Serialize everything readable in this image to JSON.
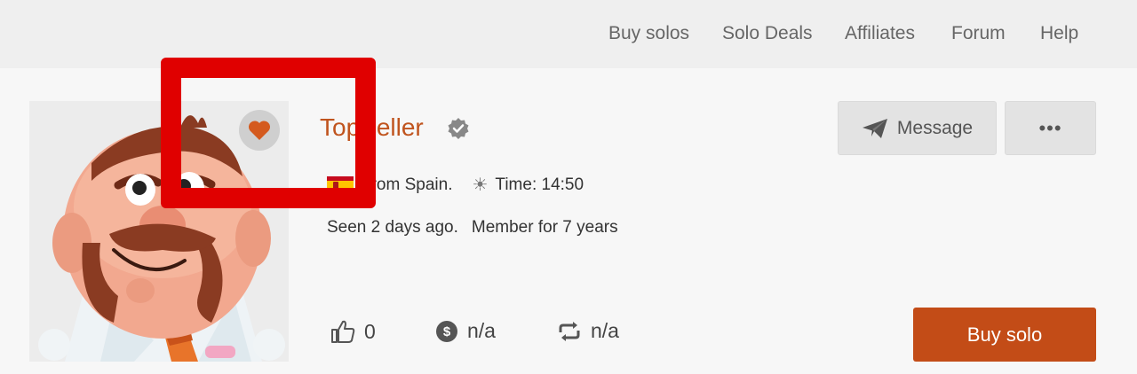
{
  "nav": {
    "items": [
      {
        "label": "Buy solos"
      },
      {
        "label": "Solo Deals"
      },
      {
        "label": "Affiliates"
      },
      {
        "label": "Forum"
      },
      {
        "label": "Help"
      }
    ]
  },
  "profile": {
    "name": "TopSeller",
    "from": "From Spain.",
    "time": "Time: 14:50",
    "seen": "Seen 2 days ago.",
    "member": "Member for 7 years"
  },
  "actions": {
    "message_label": "Message",
    "more_label": "•••",
    "buy_label": "Buy solo"
  },
  "stats": {
    "likes": "0",
    "price": "n/a",
    "repeat": "n/a"
  },
  "colors": {
    "accent": "#c34c17",
    "username": "#c0541e",
    "highlight": "#e00000"
  }
}
